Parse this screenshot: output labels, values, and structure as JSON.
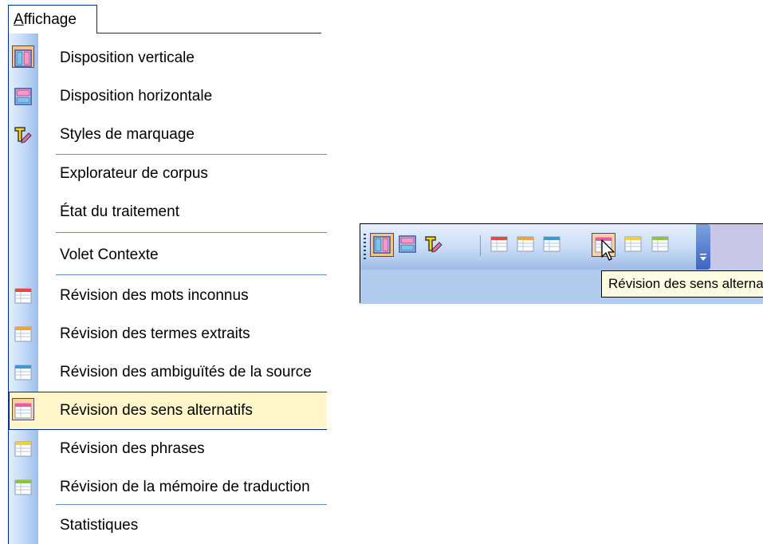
{
  "menu": {
    "title_underlined": "A",
    "title_rest": "ffichage",
    "items": [
      {
        "label": "Disposition verticale",
        "icon": "vertical-layout-icon",
        "checked": true
      },
      {
        "label": "Disposition horizontale",
        "icon": "horizontal-layout-icon"
      },
      {
        "label": "Styles de marquage",
        "icon": "markup-styles-icon"
      },
      {
        "label": "Explorateur de corpus",
        "icon": ""
      },
      {
        "label": "État du traitement",
        "icon": ""
      },
      {
        "label": "Volet Contexte",
        "icon": ""
      },
      {
        "label": "Révision des mots inconnus",
        "icon": "review-grid-red-icon"
      },
      {
        "label": "Révision des termes extraits",
        "icon": "review-grid-orange-icon"
      },
      {
        "label": "Révision des ambiguïtés de la source",
        "icon": "review-grid-blue-icon"
      },
      {
        "label": "Révision des sens alternatifs",
        "icon": "review-grid-pink-icon",
        "highlighted": true
      },
      {
        "label": "Révision des phrases",
        "icon": "review-grid-yellow-icon"
      },
      {
        "label": "Révision de la mémoire de traduction",
        "icon": "review-grid-green-icon"
      },
      {
        "label": "Statistiques",
        "icon": ""
      }
    ]
  },
  "toolbar": {
    "buttons": [
      {
        "icon": "vertical-layout-icon",
        "state": "checked"
      },
      {
        "icon": "horizontal-layout-icon"
      },
      {
        "icon": "markup-styles-icon"
      },
      {
        "icon": "review-grid-red-icon"
      },
      {
        "icon": "review-grid-orange-icon"
      },
      {
        "icon": "review-grid-blue-icon"
      },
      {
        "icon": "review-grid-pink-icon",
        "state": "hot"
      },
      {
        "icon": "review-grid-yellow-icon"
      },
      {
        "icon": "review-grid-green-icon"
      }
    ],
    "tooltip": "Révision des sens alternatifs"
  },
  "colors": {
    "menu_border": "#002d96",
    "highlight": "#fff6c9",
    "checked": "#ffc080",
    "grid_red": "#e8473c",
    "grid_orange": "#f2a23a",
    "grid_blue": "#3a9ad1",
    "grid_pink": "#e85aa8",
    "grid_yellow": "#f2cf3a",
    "grid_green": "#8cc43c"
  }
}
